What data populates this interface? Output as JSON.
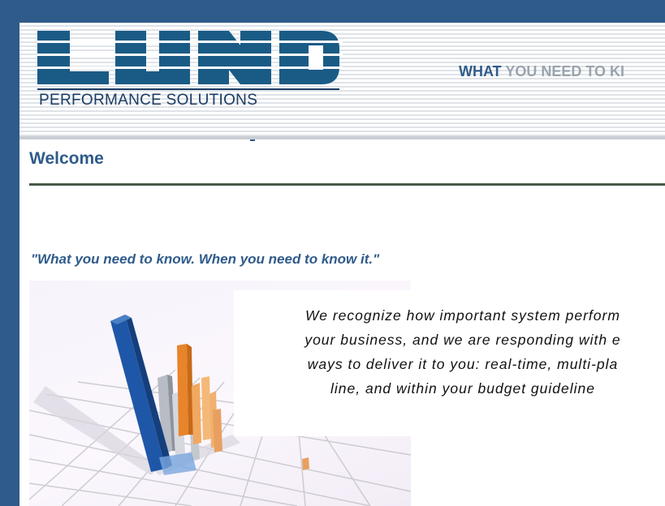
{
  "header": {
    "logo_text": "LUND",
    "logo_subtitle": "PERFORMANCE SOLUTIONS",
    "tagline_strong": "WHAT",
    "tagline_rest": " YOU NEED TO KI",
    "colors": {
      "frame": "#2f5b8a",
      "logo": "#1a5b86",
      "stripe": "#dfe3e8"
    }
  },
  "main": {
    "title": "Welcome",
    "quote": "\"What you need to know. When you need to know it.\"",
    "body_lines": [
      "We recognize how important system perform",
      "your business, and we are responding with e",
      "ways to deliver it to you: real-time, multi-pla",
      "line, and within your budget guideline"
    ],
    "illustration_icon": "3d-bar-chart-graphic"
  }
}
